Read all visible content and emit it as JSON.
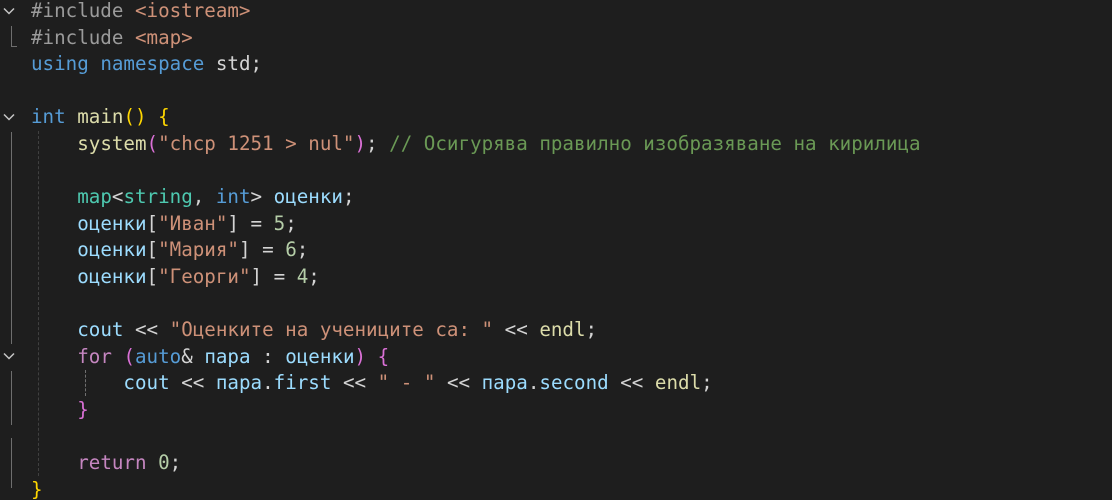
{
  "editor": {
    "theme_colors": {
      "background": "#1e1e1e",
      "keyword": "#569cd6",
      "control_keyword": "#c586c0",
      "type": "#4ec9b0",
      "function": "#dcdcaa",
      "variable": "#9cdcfe",
      "string": "#ce9178",
      "number": "#b5cea8",
      "comment": "#6a9955"
    },
    "fold_icons": [
      "chevron-down-icon",
      "chevron-down-icon",
      "chevron-down-icon"
    ],
    "lines": [
      {
        "tokens": [
          {
            "c": "pp",
            "t": "#include "
          },
          {
            "c": "ppi",
            "t": "<iostream>"
          }
        ]
      },
      {
        "tokens": [
          {
            "c": "pp",
            "t": "#include "
          },
          {
            "c": "ppi",
            "t": "<map>"
          }
        ]
      },
      {
        "tokens": [
          {
            "c": "kw",
            "t": "using"
          },
          {
            "c": "op",
            "t": " "
          },
          {
            "c": "kw",
            "t": "namespace"
          },
          {
            "c": "op",
            "t": " std;"
          }
        ]
      },
      {
        "tokens": []
      },
      {
        "tokens": [
          {
            "c": "kw",
            "t": "int"
          },
          {
            "c": "op",
            "t": " "
          },
          {
            "c": "fn",
            "t": "main"
          },
          {
            "c": "br1",
            "t": "()"
          },
          {
            "c": "op",
            "t": " "
          },
          {
            "c": "br1",
            "t": "{"
          }
        ]
      },
      {
        "tokens": [
          {
            "c": "op",
            "t": "    "
          },
          {
            "c": "fn",
            "t": "system"
          },
          {
            "c": "br2",
            "t": "("
          },
          {
            "c": "str",
            "t": "\"chcp 1251 > nul\""
          },
          {
            "c": "br2",
            "t": ")"
          },
          {
            "c": "op",
            "t": "; "
          },
          {
            "c": "cmt",
            "t": "// Осигурява правилно изобразяване на кирилица"
          }
        ]
      },
      {
        "tokens": [
          {
            "c": "op",
            "t": "    "
          }
        ]
      },
      {
        "tokens": [
          {
            "c": "op",
            "t": "    "
          },
          {
            "c": "ty",
            "t": "map"
          },
          {
            "c": "op",
            "t": "<"
          },
          {
            "c": "ty",
            "t": "string"
          },
          {
            "c": "op",
            "t": ", "
          },
          {
            "c": "kw",
            "t": "int"
          },
          {
            "c": "op",
            "t": "> "
          },
          {
            "c": "var",
            "t": "оценки"
          },
          {
            "c": "op",
            "t": ";"
          }
        ]
      },
      {
        "tokens": [
          {
            "c": "op",
            "t": "    "
          },
          {
            "c": "var",
            "t": "оценки"
          },
          {
            "c": "op",
            "t": "["
          },
          {
            "c": "str",
            "t": "\"Иван\""
          },
          {
            "c": "op",
            "t": "] = "
          },
          {
            "c": "num",
            "t": "5"
          },
          {
            "c": "op",
            "t": ";"
          }
        ]
      },
      {
        "tokens": [
          {
            "c": "op",
            "t": "    "
          },
          {
            "c": "var",
            "t": "оценки"
          },
          {
            "c": "op",
            "t": "["
          },
          {
            "c": "str",
            "t": "\"Мария\""
          },
          {
            "c": "op",
            "t": "] = "
          },
          {
            "c": "num",
            "t": "6"
          },
          {
            "c": "op",
            "t": ";"
          }
        ]
      },
      {
        "tokens": [
          {
            "c": "op",
            "t": "    "
          },
          {
            "c": "var",
            "t": "оценки"
          },
          {
            "c": "op",
            "t": "["
          },
          {
            "c": "str",
            "t": "\"Георги\""
          },
          {
            "c": "op",
            "t": "] = "
          },
          {
            "c": "num",
            "t": "4"
          },
          {
            "c": "op",
            "t": ";"
          }
        ]
      },
      {
        "tokens": [
          {
            "c": "op",
            "t": "    "
          }
        ]
      },
      {
        "tokens": [
          {
            "c": "op",
            "t": "    "
          },
          {
            "c": "var",
            "t": "cout"
          },
          {
            "c": "op",
            "t": " << "
          },
          {
            "c": "str",
            "t": "\"Оценките на учениците са: \""
          },
          {
            "c": "op",
            "t": " << "
          },
          {
            "c": "fn",
            "t": "endl"
          },
          {
            "c": "op",
            "t": ";"
          }
        ]
      },
      {
        "tokens": [
          {
            "c": "op",
            "t": "    "
          },
          {
            "c": "kwc",
            "t": "for"
          },
          {
            "c": "op",
            "t": " "
          },
          {
            "c": "br2",
            "t": "("
          },
          {
            "c": "kw",
            "t": "auto"
          },
          {
            "c": "op",
            "t": "& "
          },
          {
            "c": "var",
            "t": "пара"
          },
          {
            "c": "op",
            "t": " : "
          },
          {
            "c": "var",
            "t": "оценки"
          },
          {
            "c": "br2",
            "t": ")"
          },
          {
            "c": "op",
            "t": " "
          },
          {
            "c": "br2",
            "t": "{"
          }
        ]
      },
      {
        "tokens": [
          {
            "c": "op",
            "t": "        "
          },
          {
            "c": "var",
            "t": "cout"
          },
          {
            "c": "op",
            "t": " << "
          },
          {
            "c": "var",
            "t": "пара"
          },
          {
            "c": "op",
            "t": "."
          },
          {
            "c": "var",
            "t": "first"
          },
          {
            "c": "op",
            "t": " << "
          },
          {
            "c": "str",
            "t": "\" - \""
          },
          {
            "c": "op",
            "t": " << "
          },
          {
            "c": "var",
            "t": "пара"
          },
          {
            "c": "op",
            "t": "."
          },
          {
            "c": "var",
            "t": "second"
          },
          {
            "c": "op",
            "t": " << "
          },
          {
            "c": "fn",
            "t": "endl"
          },
          {
            "c": "op",
            "t": ";"
          }
        ]
      },
      {
        "tokens": [
          {
            "c": "op",
            "t": "    "
          },
          {
            "c": "br2",
            "t": "}"
          }
        ]
      },
      {
        "tokens": []
      },
      {
        "tokens": [
          {
            "c": "op",
            "t": "    "
          },
          {
            "c": "kwc",
            "t": "return"
          },
          {
            "c": "op",
            "t": " "
          },
          {
            "c": "num",
            "t": "0"
          },
          {
            "c": "op",
            "t": ";"
          }
        ]
      },
      {
        "tokens": [
          {
            "c": "br1",
            "t": "}"
          }
        ]
      }
    ]
  }
}
